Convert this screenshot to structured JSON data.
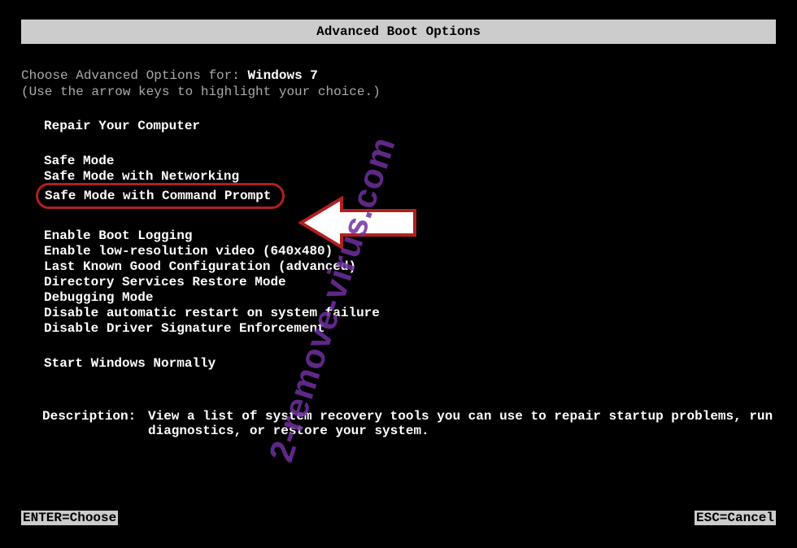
{
  "header": {
    "title": "Advanced Boot Options"
  },
  "intro": {
    "prompt_prefix": "Choose Advanced Options for: ",
    "os_name": "Windows 7",
    "hint": "(Use the arrow keys to highlight your choice.)"
  },
  "groups": {
    "repair": {
      "item1": "Repair Your Computer"
    },
    "safemode": {
      "item1": "Safe Mode",
      "item2": "Safe Mode with Networking",
      "item3": "Safe Mode with Command Prompt"
    },
    "advanced": {
      "item1": "Enable Boot Logging",
      "item2": "Enable low-resolution video (640x480)",
      "item3": "Last Known Good Configuration (advanced)",
      "item4": "Directory Services Restore Mode",
      "item5": "Debugging Mode",
      "item6": "Disable automatic restart on system failure",
      "item7": "Disable Driver Signature Enforcement"
    },
    "normal": {
      "item1": "Start Windows Normally"
    }
  },
  "description": {
    "label": "Description:",
    "text": "View a list of system recovery tools you can use to repair startup problems, run diagnostics, or restore your system."
  },
  "footer": {
    "enter": "ENTER=Choose",
    "esc": "ESC=Cancel"
  },
  "watermark": "2-remove-virus.com"
}
